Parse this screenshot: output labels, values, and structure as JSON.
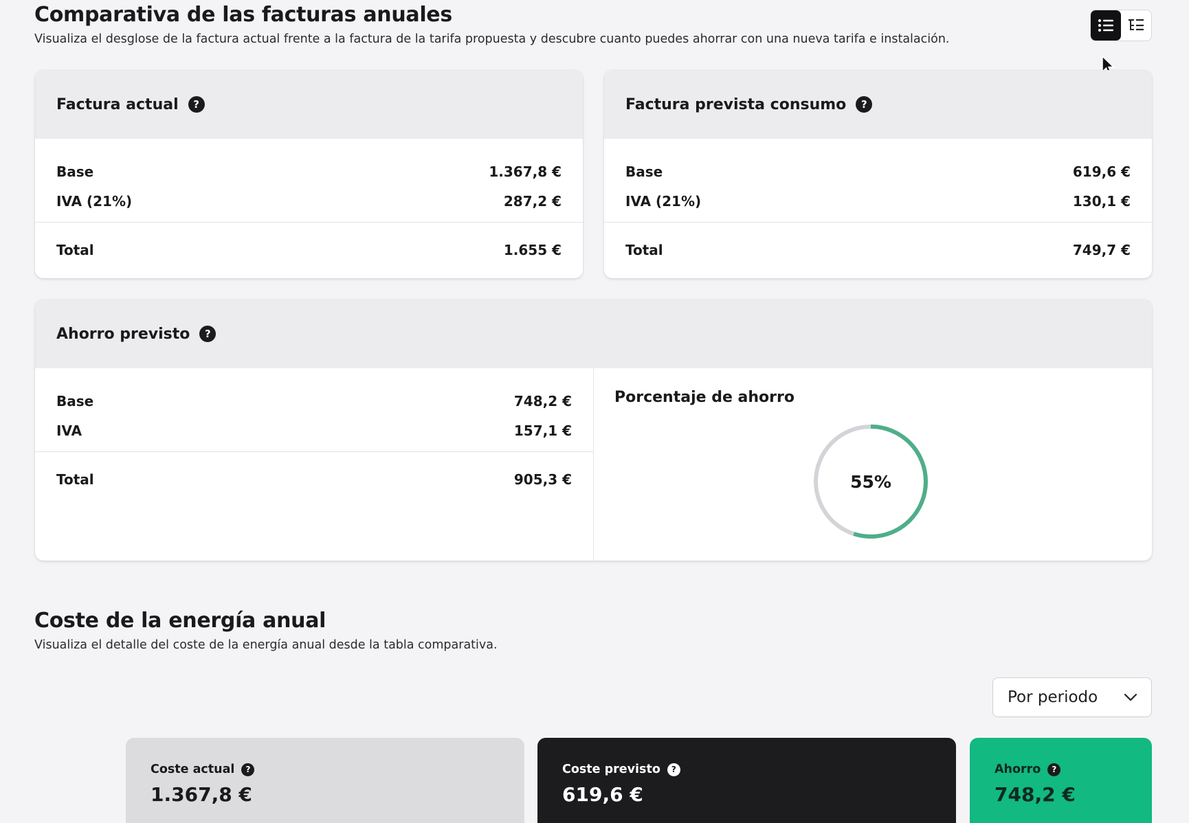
{
  "header": {
    "title": "Comparativa de las facturas anuales",
    "subtitle": "Visualiza el desglose de la factura actual frente a la factura de la tarifa propuesta y descubre cuanto puedes ahorrar con una nueva tarifa e instalación."
  },
  "view_toggle": {
    "selected": "list-view",
    "icons": [
      "list-icon",
      "tree-list-icon"
    ]
  },
  "current_bill": {
    "title": "Factura actual",
    "base_label": "Base",
    "base_value": "1.367,8 €",
    "iva_label": "IVA (21%)",
    "iva_value": "287,2 €",
    "total_label": "Total",
    "total_value": "1.655 €"
  },
  "forecast_bill": {
    "title": "Factura prevista consumo",
    "base_label": "Base",
    "base_value": "619,6 €",
    "iva_label": "IVA (21%)",
    "iva_value": "130,1 €",
    "total_label": "Total",
    "total_value": "749,7 €"
  },
  "savings": {
    "title": "Ahorro previsto",
    "base_label": "Base",
    "base_value": "748,2 €",
    "iva_label": "IVA",
    "iva_value": "157,1 €",
    "total_label": "Total",
    "total_value": "905,3 €",
    "percentage_title": "Porcentaje de ahorro",
    "percentage_text": "55%",
    "percentage_value": 0.55,
    "progress_color": "#4fae8a",
    "track_color": "#d3d4d8"
  },
  "energy_section": {
    "title": "Coste de la energía anual",
    "subtitle": "Visualiza el detalle del coste de la energía anual desde la tabla comparativa.",
    "period_select": "Por periodo"
  },
  "cost_cards": {
    "current": {
      "label": "Coste actual",
      "value": "1.367,8 €",
      "bg": "#dcdcdf"
    },
    "forecast": {
      "label": "Coste previsto",
      "value": "619,6 €",
      "bg": "#1c1c1e"
    },
    "saving": {
      "label": "Ahorro",
      "value": "748,2 €",
      "bg": "#12b981"
    }
  },
  "help_glyph": "?"
}
